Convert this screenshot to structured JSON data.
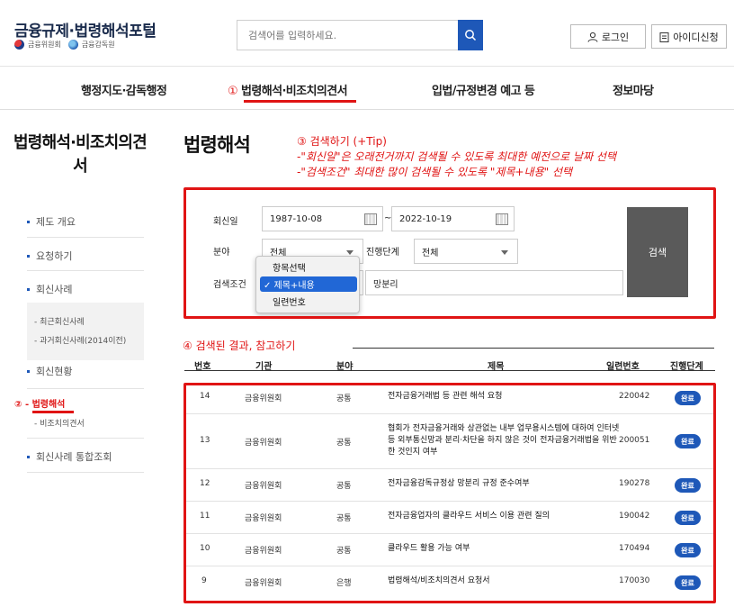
{
  "header": {
    "site_title": "금융규제·법령해석포털",
    "org1": "금융위원회",
    "org2": "금융감독원",
    "search_placeholder": "검색어를 입력하세요.",
    "login_label": "로그인",
    "signup_label": "아이디신청"
  },
  "nav": {
    "items": [
      "행정지도·감독행정",
      "법령해석·비조치의견서",
      "입법/규정변경 예고 등",
      "정보마당"
    ],
    "marker_1": "①"
  },
  "sidebar": {
    "title": "법령해석·비조치의견서",
    "items": [
      "제도 개요",
      "요청하기",
      "회신사례",
      "회신현황",
      "회신사례 통합조회"
    ],
    "sub_items": [
      "- 최근회신사례",
      "- 과거회신사례(2014이전)"
    ],
    "active_marker": "②",
    "active_item": "- 법령해석",
    "active_sub": "- 비조치의견서"
  },
  "main": {
    "title": "법령해석",
    "annotation_3": {
      "heading": "③ 검색하기 (+Tip)",
      "line1": "-\"회신일\"은 오래전거까지 검색될 수 있도록 최대한 예전으로 날짜 선택",
      "line2": "-\"검색조건\" 최대한 많이 검색될 수 있도록 \"제목+내용\" 선택"
    },
    "annotation_4": "④ 검색된 결과, 참고하기"
  },
  "form": {
    "date_label": "회신일",
    "date_from": "1987-10-08",
    "tilde": "~",
    "date_to": "2022-10-19",
    "field_label": "분야",
    "field_value": "전체",
    "stage_label": "진행단계",
    "stage_value": "전체",
    "cond_label": "검색조건",
    "keyword": "망분리",
    "search_button": "검색",
    "dropdown_options": [
      "항목선택",
      "제목+내용",
      "일련번호"
    ],
    "dropdown_selected": "✓ 제목+내용"
  },
  "table": {
    "headers": [
      "번호",
      "기관",
      "분야",
      "제목",
      "일련번호",
      "진행단계"
    ],
    "rows": [
      {
        "no": "14",
        "org": "금융위원회",
        "field": "공통",
        "title": "전자금융거래법 등 관련 해석 요청",
        "serial": "220042",
        "status": "완료"
      },
      {
        "no": "13",
        "org": "금융위원회",
        "field": "공통",
        "title": "협회가 전자금융거래와 상관없는 내부 업무용시스템에 대하여 인터넷 등 외부통신망과 분리·차단을 하지 않은 것이 전자금융거래법을 위반한 것인지 여부",
        "serial": "200051",
        "status": "완료"
      },
      {
        "no": "12",
        "org": "금융위원회",
        "field": "공통",
        "title": "전자금융감독규정상 망분리 규정 준수여부",
        "serial": "190278",
        "status": "완료"
      },
      {
        "no": "11",
        "org": "금융위원회",
        "field": "공통",
        "title": "전자금융업자의 클라우드 서비스 이용 관련 질의",
        "serial": "190042",
        "status": "완료"
      },
      {
        "no": "10",
        "org": "금융위원회",
        "field": "공통",
        "title": "클라우드 활용 가능 여부",
        "serial": "170494",
        "status": "완료"
      },
      {
        "no": "9",
        "org": "금융위원회",
        "field": "은행",
        "title": "법령해석/비조치의견서 요청서",
        "serial": "170030",
        "status": "완료"
      }
    ]
  },
  "colors": {
    "accent": "#1e58b8",
    "annotation": "#e01414",
    "search_btn": "#5a5a5a"
  }
}
